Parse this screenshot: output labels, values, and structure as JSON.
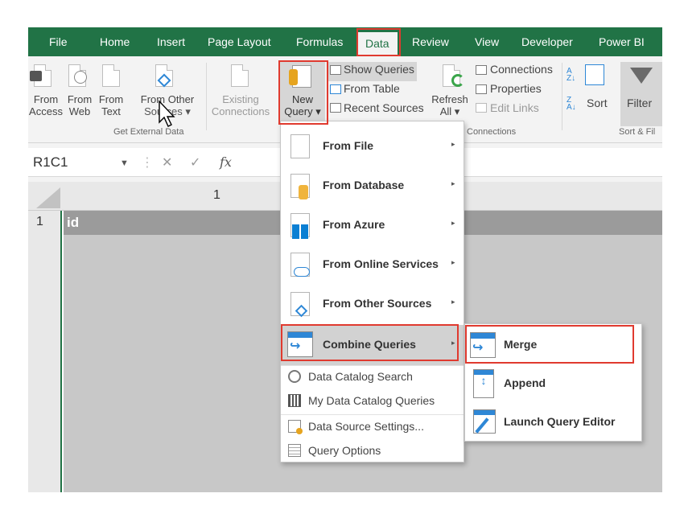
{
  "colors": {
    "excel_green": "#217346",
    "highlight": "#e03a2f"
  },
  "tabs": [
    {
      "label": "File"
    },
    {
      "label": "Home"
    },
    {
      "label": "Insert"
    },
    {
      "label": "Page Layout"
    },
    {
      "label": "Formulas"
    },
    {
      "label": "Data"
    },
    {
      "label": "Review"
    },
    {
      "label": "View"
    },
    {
      "label": "Developer"
    },
    {
      "label": "Power BI"
    }
  ],
  "ribbon": {
    "get_external": {
      "from_access": [
        "From",
        "Access"
      ],
      "from_web": [
        "From",
        "Web"
      ],
      "from_text": [
        "From",
        "Text"
      ],
      "from_other": [
        "From Other",
        "Sources"
      ],
      "group_label": "Get External Data"
    },
    "existing_connections": [
      "Existing",
      "Connections"
    ],
    "new_query": [
      "New",
      "Query"
    ],
    "show_queries": "Show Queries",
    "from_table": "From Table",
    "recent_sources": "Recent Sources",
    "refresh_all": [
      "Refresh",
      "All"
    ],
    "connections": "Connections",
    "properties": "Properties",
    "edit_links": "Edit Links",
    "connections_group": "Connections",
    "sort": "Sort",
    "filter": "Filter",
    "sort_filter_group": "Sort & Fil"
  },
  "formula_bar": {
    "name_box": "R1C1",
    "fx": "fx"
  },
  "grid": {
    "column_header": "1",
    "row_header": "1",
    "cell_value": "id"
  },
  "menu": {
    "main_items": [
      {
        "label": "From File",
        "icon": "file-icon"
      },
      {
        "label": "From Database",
        "icon": "database-icon"
      },
      {
        "label": "From Azure",
        "icon": "azure-icon"
      },
      {
        "label": "From Online Services",
        "icon": "cloud-icon"
      },
      {
        "label": "From Other Sources",
        "icon": "network-icon"
      },
      {
        "label": "Combine Queries",
        "icon": "combine-icon"
      }
    ],
    "secondary_items": [
      {
        "label": "Data Catalog Search",
        "icon": "catalog-search-icon"
      },
      {
        "label": "My Data Catalog Queries",
        "icon": "catalog-queries-icon"
      },
      {
        "label": "Data Source Settings...",
        "icon": "data-source-settings-icon"
      },
      {
        "label": "Query Options",
        "icon": "query-options-icon"
      }
    ]
  },
  "submenu": {
    "items": [
      {
        "label": "Merge",
        "icon": "merge-icon"
      },
      {
        "label": "Append",
        "icon": "append-icon"
      },
      {
        "label": "Launch Query Editor",
        "icon": "query-editor-icon"
      }
    ]
  }
}
